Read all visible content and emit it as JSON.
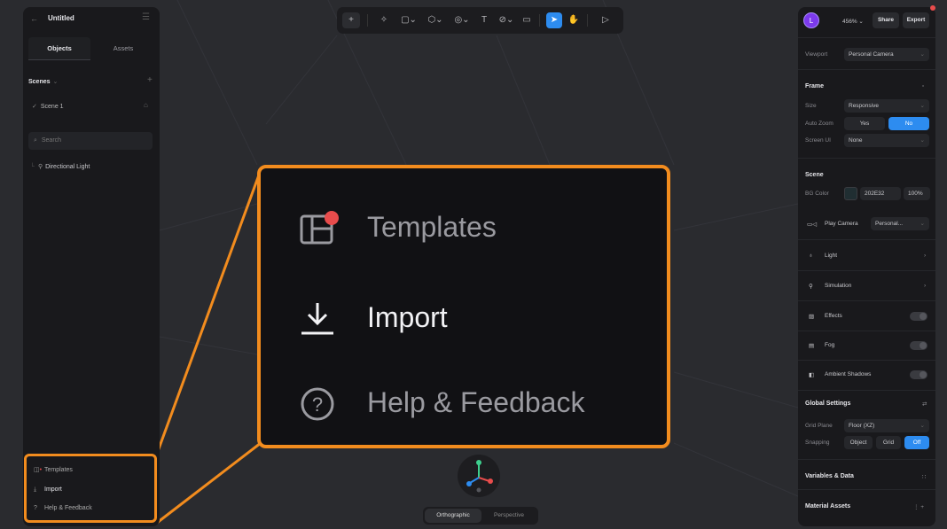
{
  "left_panel": {
    "title": "Untitled",
    "tabs": [
      "Objects",
      "Assets"
    ],
    "scenes_label": "Scenes",
    "scene_name": "Scene 1",
    "search_placeholder": "Search",
    "tree_item": "Directional Light",
    "bottom_menu": [
      "Templates",
      "Import",
      "Help & Feedback"
    ]
  },
  "callout": {
    "items": [
      "Templates",
      "Import",
      "Help & Feedback"
    ]
  },
  "viewport": {
    "view_modes": [
      "Orthographic",
      "Perspective"
    ],
    "active_view_mode": "Orthographic"
  },
  "right_panel": {
    "avatar_letter": "L",
    "zoom": "456%",
    "share_label": "Share",
    "export_label": "Export",
    "viewport_label": "Viewport",
    "viewport_value": "Personal Camera",
    "frame": {
      "heading": "Frame",
      "size_label": "Size",
      "size_value": "Responsive",
      "autozoom_label": "Auto Zoom",
      "autozoom_yes": "Yes",
      "autozoom_no": "No",
      "screenui_label": "Screen UI",
      "screenui_value": "None"
    },
    "scene": {
      "heading": "Scene",
      "bg_label": "BG Color",
      "bg_hex": "202E32",
      "bg_opacity": "100%",
      "play_camera_label": "Play Camera",
      "play_camera_value": "Personal...",
      "light_label": "Light",
      "simulation_label": "Simulation",
      "effects_label": "Effects",
      "fog_label": "Fog",
      "ambient_label": "Ambient Shadows"
    },
    "global": {
      "heading": "Global Settings",
      "grid_label": "Grid Plane",
      "grid_value": "Floor (XZ)",
      "snapping_label": "Snapping",
      "snap_object": "Object",
      "snap_grid": "Grid",
      "snap_off": "Off"
    },
    "variables_heading": "Variables & Data",
    "material_heading": "Material Assets"
  },
  "colors": {
    "accent": "#2d8cf0",
    "highlight": "#f28c1e",
    "badge": "#e84c4c"
  }
}
